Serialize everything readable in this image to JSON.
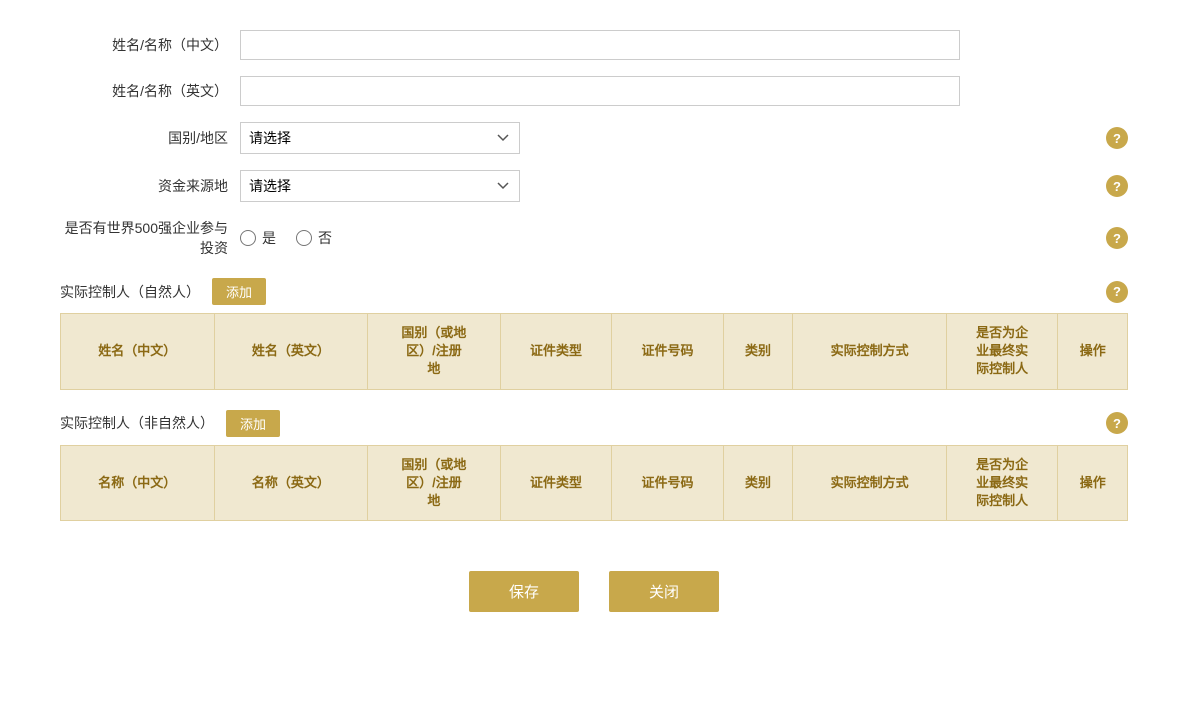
{
  "form": {
    "name_cn_label": "姓名/名称（中文）",
    "name_en_label": "姓名/名称（英文）",
    "country_label": "国别/地区",
    "fund_source_label": "资金来源地",
    "fortune500_label": "是否有世界500强企业参与投资",
    "name_cn_value": "",
    "name_en_value": "",
    "country_placeholder": "请选择",
    "fund_source_placeholder": "请选择",
    "fortune500_yes": "是",
    "fortune500_no": "否"
  },
  "natural_person_section": {
    "title": "实际控制人（自然人）",
    "add_label": "添加",
    "columns": [
      "姓名（中文）",
      "姓名（英文）",
      "国别（或地\n区）/注册\n地",
      "证件类型",
      "证件号码",
      "类别",
      "实际控制方式",
      "是否为企\n业最终实\n际控制人",
      "操作"
    ]
  },
  "non_natural_person_section": {
    "title": "实际控制人（非自然人）",
    "add_label": "添加",
    "columns": [
      "名称（中文）",
      "名称（英文）",
      "国别（或地\n区）/注册\n地",
      "证件类型",
      "证件号码",
      "类别",
      "实际控制方式",
      "是否为企\n业最终实\n际控制人",
      "操作"
    ]
  },
  "buttons": {
    "save": "保存",
    "close": "关闭"
  },
  "help_icon": "?",
  "colors": {
    "gold": "#c8a84b",
    "table_header_bg": "#f0e8d0",
    "table_header_text": "#8b6914"
  }
}
